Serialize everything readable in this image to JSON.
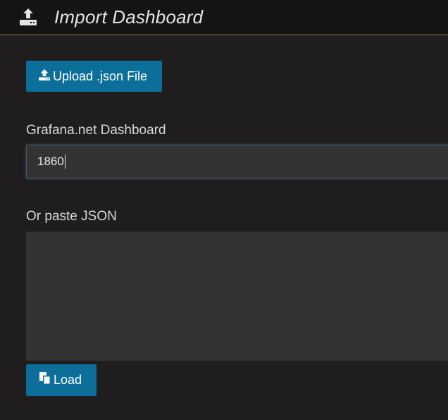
{
  "header": {
    "title": "Import Dashboard",
    "icon": "upload-icon"
  },
  "upload_button": {
    "label": "Upload .json File",
    "icon": "upload-icon"
  },
  "grafana_net": {
    "label": "Grafana.net Dashboard",
    "value": "1860"
  },
  "paste_json": {
    "label": "Or paste JSON",
    "value": ""
  },
  "load_button": {
    "label": "Load",
    "icon": "copy-icon"
  },
  "colors": {
    "background": "#1f1d1e",
    "header_background": "#141414",
    "header_border": "#a7772d",
    "button": "#0b6f9a",
    "input_background": "#333333"
  }
}
